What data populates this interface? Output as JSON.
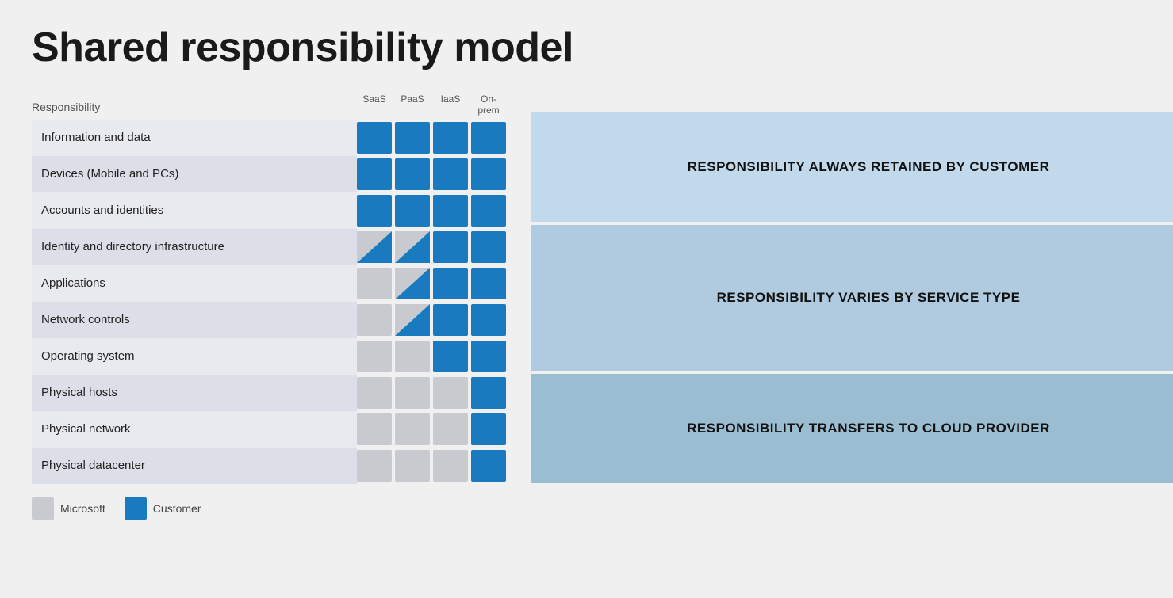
{
  "title": "Shared responsibility model",
  "table": {
    "header": {
      "responsibility_label": "Responsibility",
      "columns": [
        "SaaS",
        "PaaS",
        "IaaS",
        "On-\nprem"
      ]
    },
    "rows": [
      {
        "label": "Information and data",
        "cells": [
          "blue",
          "blue",
          "blue",
          "blue"
        ]
      },
      {
        "label": "Devices (Mobile and PCs)",
        "cells": [
          "blue",
          "blue",
          "blue",
          "blue"
        ]
      },
      {
        "label": "Accounts and identities",
        "cells": [
          "blue",
          "blue",
          "blue",
          "blue"
        ]
      },
      {
        "label": "Identity and directory infrastructure",
        "cells": [
          "split",
          "split",
          "blue",
          "blue"
        ]
      },
      {
        "label": "Applications",
        "cells": [
          "gray",
          "split",
          "blue",
          "blue"
        ]
      },
      {
        "label": "Network controls",
        "cells": [
          "gray",
          "split",
          "blue",
          "blue"
        ]
      },
      {
        "label": "Operating system",
        "cells": [
          "gray",
          "gray",
          "blue",
          "blue"
        ]
      },
      {
        "label": "Physical hosts",
        "cells": [
          "gray",
          "gray",
          "gray",
          "blue"
        ]
      },
      {
        "label": "Physical network",
        "cells": [
          "gray",
          "gray",
          "gray",
          "blue"
        ]
      },
      {
        "label": "Physical datacenter",
        "cells": [
          "gray",
          "gray",
          "gray",
          "blue"
        ]
      }
    ]
  },
  "arrows": [
    {
      "label": "RESPONSIBILITY ALWAYS RETAINED BY CUSTOMER",
      "rows": 3,
      "color_start": "#b8d4e8",
      "color_end": "#c5dff0"
    },
    {
      "label": "RESPONSIBILITY VARIES BY SERVICE TYPE",
      "rows": 4,
      "color_start": "#a8c8de",
      "color_end": "#bed8ec"
    },
    {
      "label": "RESPONSIBILITY TRANSFERS TO CLOUD PROVIDER",
      "rows": 3,
      "color_start": "#98b8ce",
      "color_end": "#b4cede"
    }
  ],
  "legend": {
    "items": [
      {
        "label": "Microsoft",
        "type": "gray"
      },
      {
        "label": "Customer",
        "type": "blue"
      }
    ]
  }
}
